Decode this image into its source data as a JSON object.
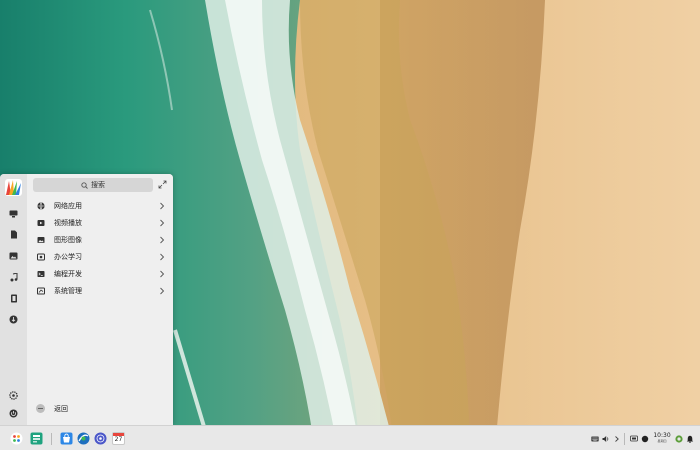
{
  "launcher": {
    "search_placeholder": "搜索",
    "categories": [
      {
        "label": "网络应用",
        "icon": "globe-icon"
      },
      {
        "label": "视频播放",
        "icon": "video-icon"
      },
      {
        "label": "图形图像",
        "icon": "image-icon"
      },
      {
        "label": "办公学习",
        "icon": "office-icon"
      },
      {
        "label": "编程开发",
        "icon": "terminal-icon"
      },
      {
        "label": "系统管理",
        "icon": "system-icon"
      }
    ],
    "back_label": "返回",
    "rail_icons": [
      "monitor-icon",
      "document-icon",
      "picture-icon",
      "music-icon",
      "video-file-icon",
      "download-icon",
      "settings-icon",
      "power-icon"
    ]
  },
  "taskbar": {
    "calendar_day": "27",
    "clock_time": "10:30",
    "clock_weekday": "星期四",
    "pinned_apps": [
      "launcher-icon",
      "multitask-icon",
      "app-store-icon",
      "browser-icon",
      "music-player-icon",
      "calendar-icon"
    ]
  },
  "colors": {
    "panel": "#efefef",
    "rail": "#e1e1e1",
    "taskbar": "#e8e8e8",
    "sea_deep": "#1f8a72",
    "sand": "#e9c38e"
  }
}
